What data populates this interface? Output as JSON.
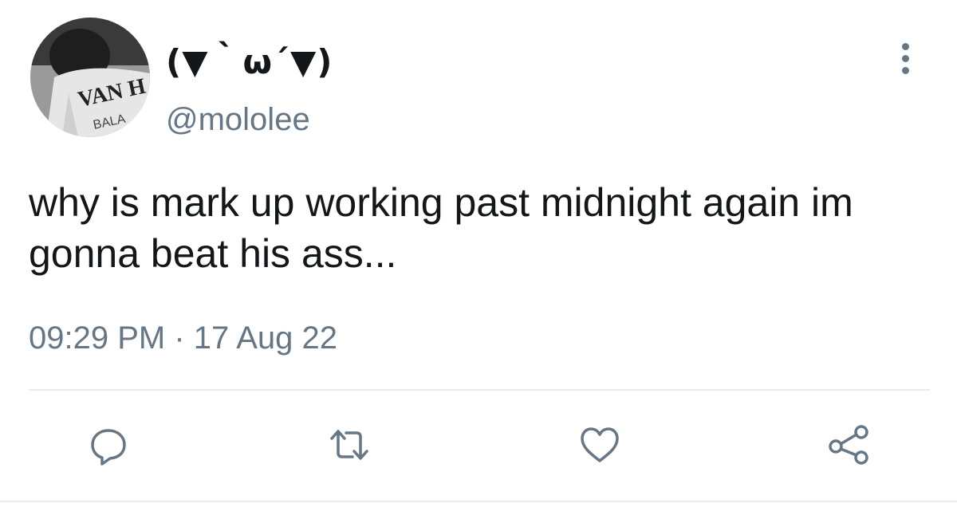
{
  "tweet": {
    "author": {
      "display_name": "(▼｀ω´▼)",
      "handle": "@mololee",
      "avatar_text": "VAN H",
      "avatar_subtext": "BALA"
    },
    "text": "why is mark up working past midnight again im gonna beat his ass...",
    "time": "09:29 PM",
    "separator": "·",
    "date": "17 Aug 22"
  },
  "actions": {
    "reply_icon": "reply-icon",
    "retweet_icon": "retweet-icon",
    "like_icon": "like-icon",
    "share_icon": "share-icon"
  },
  "colors": {
    "text": "#14171a",
    "secondary": "#657786",
    "icon": "#657786",
    "divider": "#e6ecf0"
  }
}
